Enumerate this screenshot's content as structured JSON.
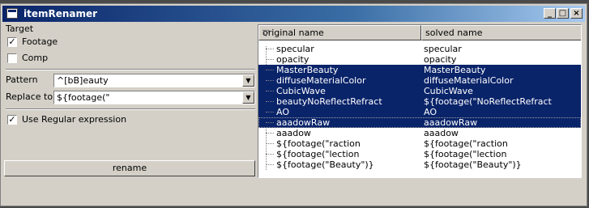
{
  "window": {
    "title": "itemRenamer"
  },
  "target": {
    "label": "Target",
    "footage": {
      "label": "Footage",
      "checked": true
    },
    "comp": {
      "label": "Comp",
      "checked": false
    }
  },
  "pattern": {
    "label": "Pattern",
    "value": "^[bB]eauty"
  },
  "replace": {
    "label": "Replace to",
    "value": "${footage(\""
  },
  "regex": {
    "label": "Use Regular expression",
    "checked": true
  },
  "rename_button": "rename",
  "table": {
    "columns": [
      "original name",
      "solved name"
    ],
    "rows": [
      {
        "original": "specular",
        "solved": "specular",
        "selected": false
      },
      {
        "original": "opacity",
        "solved": "opacity",
        "selected": false
      },
      {
        "original": "MasterBeauty",
        "solved": "MasterBeauty",
        "selected": true
      },
      {
        "original": "diffuseMaterialColor",
        "solved": "diffuseMaterialColor",
        "selected": true
      },
      {
        "original": "CubicWave",
        "solved": "CubicWave",
        "selected": true
      },
      {
        "original": "beautyNoReflectRefract",
        "solved": "${footage(\"NoReflectRefract",
        "selected": true
      },
      {
        "original": "AO",
        "solved": "AO",
        "selected": true
      },
      {
        "original": "aaadowRaw",
        "solved": "aaadowRaw",
        "selected": true
      },
      {
        "original": "aaadow",
        "solved": "aaadow",
        "selected": false
      },
      {
        "original": "${footage(\"raction",
        "solved": "${footage(\"raction",
        "selected": false
      },
      {
        "original": "${footage(\"lection",
        "solved": "${footage(\"lection",
        "selected": false
      },
      {
        "original": "${footage(\"Beauty\")}",
        "solved": "${footage(\"Beauty\")}",
        "selected": false
      }
    ]
  },
  "icons": {
    "app": "app-window-icon",
    "minimize": "minimize-icon",
    "maximize": "maximize-icon",
    "close": "close-icon",
    "sort": "sort-descending-icon",
    "dropdown": "chevron-down-icon"
  }
}
